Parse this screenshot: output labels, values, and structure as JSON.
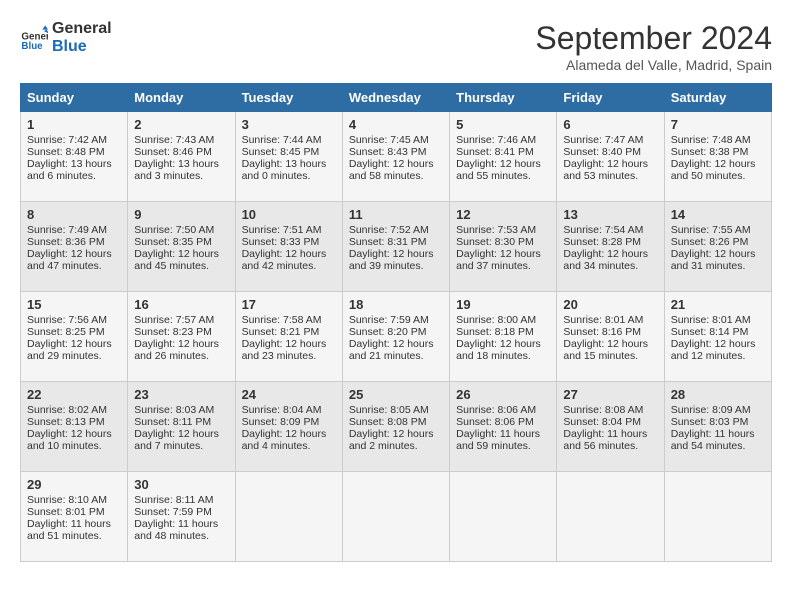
{
  "header": {
    "logo_line1": "General",
    "logo_line2": "Blue",
    "month": "September 2024",
    "location": "Alameda del Valle, Madrid, Spain"
  },
  "days_of_week": [
    "Sunday",
    "Monday",
    "Tuesday",
    "Wednesday",
    "Thursday",
    "Friday",
    "Saturday"
  ],
  "weeks": [
    [
      {
        "day": "1",
        "lines": [
          "Sunrise: 7:42 AM",
          "Sunset: 8:48 PM",
          "Daylight: 13 hours",
          "and 6 minutes."
        ]
      },
      {
        "day": "2",
        "lines": [
          "Sunrise: 7:43 AM",
          "Sunset: 8:46 PM",
          "Daylight: 13 hours",
          "and 3 minutes."
        ]
      },
      {
        "day": "3",
        "lines": [
          "Sunrise: 7:44 AM",
          "Sunset: 8:45 PM",
          "Daylight: 13 hours",
          "and 0 minutes."
        ]
      },
      {
        "day": "4",
        "lines": [
          "Sunrise: 7:45 AM",
          "Sunset: 8:43 PM",
          "Daylight: 12 hours",
          "and 58 minutes."
        ]
      },
      {
        "day": "5",
        "lines": [
          "Sunrise: 7:46 AM",
          "Sunset: 8:41 PM",
          "Daylight: 12 hours",
          "and 55 minutes."
        ]
      },
      {
        "day": "6",
        "lines": [
          "Sunrise: 7:47 AM",
          "Sunset: 8:40 PM",
          "Daylight: 12 hours",
          "and 53 minutes."
        ]
      },
      {
        "day": "7",
        "lines": [
          "Sunrise: 7:48 AM",
          "Sunset: 8:38 PM",
          "Daylight: 12 hours",
          "and 50 minutes."
        ]
      }
    ],
    [
      {
        "day": "8",
        "lines": [
          "Sunrise: 7:49 AM",
          "Sunset: 8:36 PM",
          "Daylight: 12 hours",
          "and 47 minutes."
        ]
      },
      {
        "day": "9",
        "lines": [
          "Sunrise: 7:50 AM",
          "Sunset: 8:35 PM",
          "Daylight: 12 hours",
          "and 45 minutes."
        ]
      },
      {
        "day": "10",
        "lines": [
          "Sunrise: 7:51 AM",
          "Sunset: 8:33 PM",
          "Daylight: 12 hours",
          "and 42 minutes."
        ]
      },
      {
        "day": "11",
        "lines": [
          "Sunrise: 7:52 AM",
          "Sunset: 8:31 PM",
          "Daylight: 12 hours",
          "and 39 minutes."
        ]
      },
      {
        "day": "12",
        "lines": [
          "Sunrise: 7:53 AM",
          "Sunset: 8:30 PM",
          "Daylight: 12 hours",
          "and 37 minutes."
        ]
      },
      {
        "day": "13",
        "lines": [
          "Sunrise: 7:54 AM",
          "Sunset: 8:28 PM",
          "Daylight: 12 hours",
          "and 34 minutes."
        ]
      },
      {
        "day": "14",
        "lines": [
          "Sunrise: 7:55 AM",
          "Sunset: 8:26 PM",
          "Daylight: 12 hours",
          "and 31 minutes."
        ]
      }
    ],
    [
      {
        "day": "15",
        "lines": [
          "Sunrise: 7:56 AM",
          "Sunset: 8:25 PM",
          "Daylight: 12 hours",
          "and 29 minutes."
        ]
      },
      {
        "day": "16",
        "lines": [
          "Sunrise: 7:57 AM",
          "Sunset: 8:23 PM",
          "Daylight: 12 hours",
          "and 26 minutes."
        ]
      },
      {
        "day": "17",
        "lines": [
          "Sunrise: 7:58 AM",
          "Sunset: 8:21 PM",
          "Daylight: 12 hours",
          "and 23 minutes."
        ]
      },
      {
        "day": "18",
        "lines": [
          "Sunrise: 7:59 AM",
          "Sunset: 8:20 PM",
          "Daylight: 12 hours",
          "and 21 minutes."
        ]
      },
      {
        "day": "19",
        "lines": [
          "Sunrise: 8:00 AM",
          "Sunset: 8:18 PM",
          "Daylight: 12 hours",
          "and 18 minutes."
        ]
      },
      {
        "day": "20",
        "lines": [
          "Sunrise: 8:01 AM",
          "Sunset: 8:16 PM",
          "Daylight: 12 hours",
          "and 15 minutes."
        ]
      },
      {
        "day": "21",
        "lines": [
          "Sunrise: 8:01 AM",
          "Sunset: 8:14 PM",
          "Daylight: 12 hours",
          "and 12 minutes."
        ]
      }
    ],
    [
      {
        "day": "22",
        "lines": [
          "Sunrise: 8:02 AM",
          "Sunset: 8:13 PM",
          "Daylight: 12 hours",
          "and 10 minutes."
        ]
      },
      {
        "day": "23",
        "lines": [
          "Sunrise: 8:03 AM",
          "Sunset: 8:11 PM",
          "Daylight: 12 hours",
          "and 7 minutes."
        ]
      },
      {
        "day": "24",
        "lines": [
          "Sunrise: 8:04 AM",
          "Sunset: 8:09 PM",
          "Daylight: 12 hours",
          "and 4 minutes."
        ]
      },
      {
        "day": "25",
        "lines": [
          "Sunrise: 8:05 AM",
          "Sunset: 8:08 PM",
          "Daylight: 12 hours",
          "and 2 minutes."
        ]
      },
      {
        "day": "26",
        "lines": [
          "Sunrise: 8:06 AM",
          "Sunset: 8:06 PM",
          "Daylight: 11 hours",
          "and 59 minutes."
        ]
      },
      {
        "day": "27",
        "lines": [
          "Sunrise: 8:08 AM",
          "Sunset: 8:04 PM",
          "Daylight: 11 hours",
          "and 56 minutes."
        ]
      },
      {
        "day": "28",
        "lines": [
          "Sunrise: 8:09 AM",
          "Sunset: 8:03 PM",
          "Daylight: 11 hours",
          "and 54 minutes."
        ]
      }
    ],
    [
      {
        "day": "29",
        "lines": [
          "Sunrise: 8:10 AM",
          "Sunset: 8:01 PM",
          "Daylight: 11 hours",
          "and 51 minutes."
        ]
      },
      {
        "day": "30",
        "lines": [
          "Sunrise: 8:11 AM",
          "Sunset: 7:59 PM",
          "Daylight: 11 hours",
          "and 48 minutes."
        ]
      },
      {
        "day": "",
        "lines": []
      },
      {
        "day": "",
        "lines": []
      },
      {
        "day": "",
        "lines": []
      },
      {
        "day": "",
        "lines": []
      },
      {
        "day": "",
        "lines": []
      }
    ]
  ]
}
